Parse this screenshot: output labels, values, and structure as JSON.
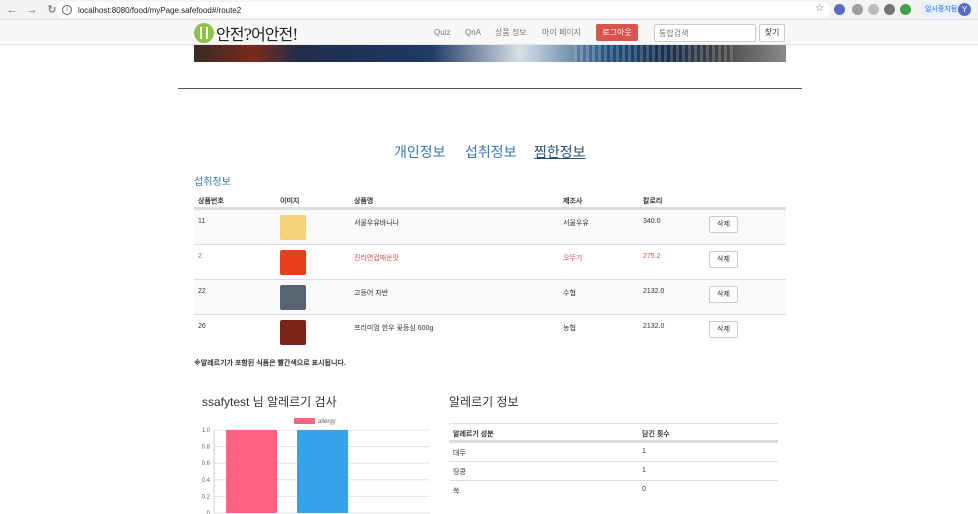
{
  "browser": {
    "url": "localhost:8080/food/myPage.safefood#/route2",
    "pause_label": "일시중지됨",
    "avatar_letter": "Y"
  },
  "header": {
    "logo_text": "안전?어안전!",
    "nav": [
      "Quiz",
      "QnA",
      "상품 정보",
      "마이 페이지"
    ],
    "logout_label": "로그아웃",
    "search_placeholder": "통합검색",
    "search_button": "찾기"
  },
  "tabs": [
    "개인정보",
    "섭취정보",
    "찜한정보"
  ],
  "section_title": "섭취정보",
  "product_table": {
    "headers": [
      "상품번호",
      "이미지",
      "상품명",
      "제조사",
      "칼로리"
    ],
    "rows": [
      {
        "id": "11",
        "name": "서울우유바나나",
        "maker": "서울우유",
        "kcal": "340.0",
        "allergy": false,
        "thumb_color": "#f3d27a"
      },
      {
        "id": "2",
        "name": "진라면컵매운맛",
        "maker": "오뚜기",
        "kcal": "275.2",
        "allergy": true,
        "thumb_color": "#e8401c"
      },
      {
        "id": "22",
        "name": "고등어 자반",
        "maker": "수협",
        "kcal": "2132.0",
        "allergy": false,
        "thumb_color": "#5a6470"
      },
      {
        "id": "26",
        "name": "프리미엄 한우 꽃등심 600g",
        "maker": "농협",
        "kcal": "2132.0",
        "allergy": false,
        "thumb_color": "#7a2418"
      }
    ],
    "delete_label": "삭제"
  },
  "note": "※알레르기가 포함된 식품은 빨간색으로 표시됩니다.",
  "chart_title": "ssafytest 님 알레르기 검사",
  "chart_data": {
    "type": "bar",
    "series": [
      {
        "name": "allergy",
        "values": [
          1,
          1
        ]
      }
    ],
    "bar_colors": [
      "#ff6384",
      "#36a2eb"
    ],
    "ylim": [
      0,
      1.0
    ],
    "yticks": [
      "1.0",
      "0.8",
      "0.6",
      "0.4",
      "0.2",
      "0"
    ]
  },
  "info_title": "알레르기 정보",
  "allergy_table": {
    "headers": [
      "알레르기 성분",
      "담긴 횟수"
    ],
    "rows": [
      {
        "name": "대두",
        "count": "1"
      },
      {
        "name": "땅콩",
        "count": "1"
      },
      {
        "name": "쑥",
        "count": "0"
      }
    ]
  }
}
